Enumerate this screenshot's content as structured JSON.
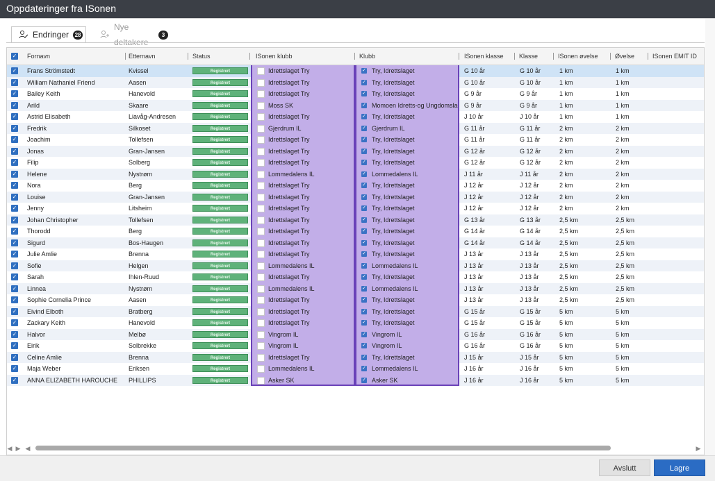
{
  "window": {
    "title": "Oppdateringer fra ISonen"
  },
  "tabs": [
    {
      "label": "Endringer",
      "count": "28",
      "icon": "user-edit-icon",
      "active": true
    },
    {
      "label": "Nye deltakere",
      "count": "3",
      "icon": "user-add-icon",
      "active": false
    }
  ],
  "table": {
    "columns": [
      "Fornavn",
      "Etternavn",
      "Status",
      "ISonen klubb",
      "Klubb",
      "ISonen klasse",
      "Klasse",
      "ISonen øvelse",
      "Øvelse",
      "ISonen EMIT ID"
    ],
    "rows": [
      [
        "Frans Strömstedt",
        "Kvissel",
        "Registrert",
        "Idrettslaget Try",
        "Try, Idrettslaget",
        "G 10 år",
        "G 10 år",
        "1 km",
        "1 km"
      ],
      [
        "William Nathaniel Friend",
        "Aasen",
        "Registrert",
        "Idrettslaget Try",
        "Try, Idrettslaget",
        "G 10 år",
        "G 10 år",
        "1 km",
        "1 km"
      ],
      [
        "Bailey Keith",
        "Hanevold",
        "Registrert",
        "Idrettslaget Try",
        "Try, Idrettslaget",
        "G 9 år",
        "G 9 år",
        "1 km",
        "1 km"
      ],
      [
        "Arild",
        "Skaare",
        "Registrert",
        "Moss SK",
        "Momoen Idretts-og Ungdomslag",
        "G 9 år",
        "G 9 år",
        "1 km",
        "1 km"
      ],
      [
        "Astrid Elisabeth",
        "Liavåg-Andresen",
        "Registrert",
        "Idrettslaget Try",
        "Try, Idrettslaget",
        "J 10 år",
        "J 10 år",
        "1 km",
        "1 km"
      ],
      [
        "Fredrik",
        "Silkoset",
        "Registrert",
        "Gjerdrum IL",
        "Gjerdrum IL",
        "G 11 år",
        "G 11 år",
        "2 km",
        "2 km"
      ],
      [
        "Joachim",
        "Tollefsen",
        "Registrert",
        "Idrettslaget Try",
        "Try, Idrettslaget",
        "G 11 år",
        "G 11 år",
        "2 km",
        "2 km"
      ],
      [
        "Jonas",
        "Gran-Jansen",
        "Registrert",
        "Idrettslaget Try",
        "Try, Idrettslaget",
        "G 12 år",
        "G 12 år",
        "2 km",
        "2 km"
      ],
      [
        "Filip",
        "Solberg",
        "Registrert",
        "Idrettslaget Try",
        "Try, Idrettslaget",
        "G 12 år",
        "G 12 år",
        "2 km",
        "2 km"
      ],
      [
        "Helene",
        "Nystrøm",
        "Registrert",
        "Lommedalens IL",
        "Lommedalens IL",
        "J 11 år",
        "J 11 år",
        "2 km",
        "2 km"
      ],
      [
        "Nora",
        "Berg",
        "Registrert",
        "Idrettslaget Try",
        "Try, Idrettslaget",
        "J 12 år",
        "J 12 år",
        "2 km",
        "2 km"
      ],
      [
        "Louise",
        "Gran-Jansen",
        "Registrert",
        "Idrettslaget Try",
        "Try, Idrettslaget",
        "J 12 år",
        "J 12 år",
        "2 km",
        "2 km"
      ],
      [
        "Jenny",
        "Litsheim",
        "Registrert",
        "Idrettslaget Try",
        "Try, Idrettslaget",
        "J 12 år",
        "J 12 år",
        "2 km",
        "2 km"
      ],
      [
        "Johan Christopher",
        "Tollefsen",
        "Registrert",
        "Idrettslaget Try",
        "Try, Idrettslaget",
        "G 13 år",
        "G 13 år",
        "2,5 km",
        "2,5 km"
      ],
      [
        "Thorodd",
        "Berg",
        "Registrert",
        "Idrettslaget Try",
        "Try, Idrettslaget",
        "G 14 år",
        "G 14 år",
        "2,5 km",
        "2,5 km"
      ],
      [
        "Sigurd",
        "Bos-Haugen",
        "Registrert",
        "Idrettslaget Try",
        "Try, Idrettslaget",
        "G 14 år",
        "G 14 år",
        "2,5 km",
        "2,5 km"
      ],
      [
        "Julie Amlie",
        "Brenna",
        "Registrert",
        "Idrettslaget Try",
        "Try, Idrettslaget",
        "J 13 år",
        "J 13 år",
        "2,5 km",
        "2,5 km"
      ],
      [
        "Sofie",
        "Helgen",
        "Registrert",
        "Lommedalens IL",
        "Lommedalens IL",
        "J 13 år",
        "J 13 år",
        "2,5 km",
        "2,5 km"
      ],
      [
        "Sarah",
        "Ihlen-Ruud",
        "Registrert",
        "Idrettslaget Try",
        "Try, Idrettslaget",
        "J 13 år",
        "J 13 år",
        "2,5 km",
        "2,5 km"
      ],
      [
        "Linnea",
        "Nystrøm",
        "Registrert",
        "Lommedalens IL",
        "Lommedalens IL",
        "J 13 år",
        "J 13 år",
        "2,5 km",
        "2,5 km"
      ],
      [
        "Sophie Cornelia Prince",
        "Aasen",
        "Registrert",
        "Idrettslaget Try",
        "Try, Idrettslaget",
        "J 13 år",
        "J 13 år",
        "2,5 km",
        "2,5 km"
      ],
      [
        "Eivind Elboth",
        "Bratberg",
        "Registrert",
        "Idrettslaget Try",
        "Try, Idrettslaget",
        "G 15 år",
        "G 15 år",
        "5 km",
        "5 km"
      ],
      [
        "Zackary Keith",
        "Hanevold",
        "Registrert",
        "Idrettslaget Try",
        "Try, Idrettslaget",
        "G 15 år",
        "G 15 år",
        "5 km",
        "5 km"
      ],
      [
        "Halvor",
        "Melbø",
        "Registrert",
        "Vingrom IL",
        "Vingrom IL",
        "G 16 år",
        "G 16 år",
        "5 km",
        "5 km"
      ],
      [
        "Eirik",
        "Solbrekke",
        "Registrert",
        "Vingrom IL",
        "Vingrom IL",
        "G 16 år",
        "G 16 år",
        "5 km",
        "5 km"
      ],
      [
        "Celine Amlie",
        "Brenna",
        "Registrert",
        "Idrettslaget Try",
        "Try, Idrettslaget",
        "J 15 år",
        "J 15 år",
        "5 km",
        "5 km"
      ],
      [
        "Maja Weber",
        "Eriksen",
        "Registrert",
        "Lommedalens IL",
        "Lommedalens IL",
        "J 16 år",
        "J 16 år",
        "5 km",
        "5 km"
      ],
      [
        "ANNA ELIZABETH HAROUCHE",
        "PHILLIPS",
        "Registrert",
        "Asker SK",
        "Asker SK",
        "J 16 år",
        "J 16 år",
        "5 km",
        "5 km"
      ]
    ]
  },
  "footer": {
    "cancel_label": "Avslutt",
    "save_label": "Lagre"
  },
  "colors": {
    "accent": "#2b6cc4",
    "status": "#5fb27a",
    "club_highlight": "#c2aee8",
    "club_border": "#6a42b8"
  }
}
